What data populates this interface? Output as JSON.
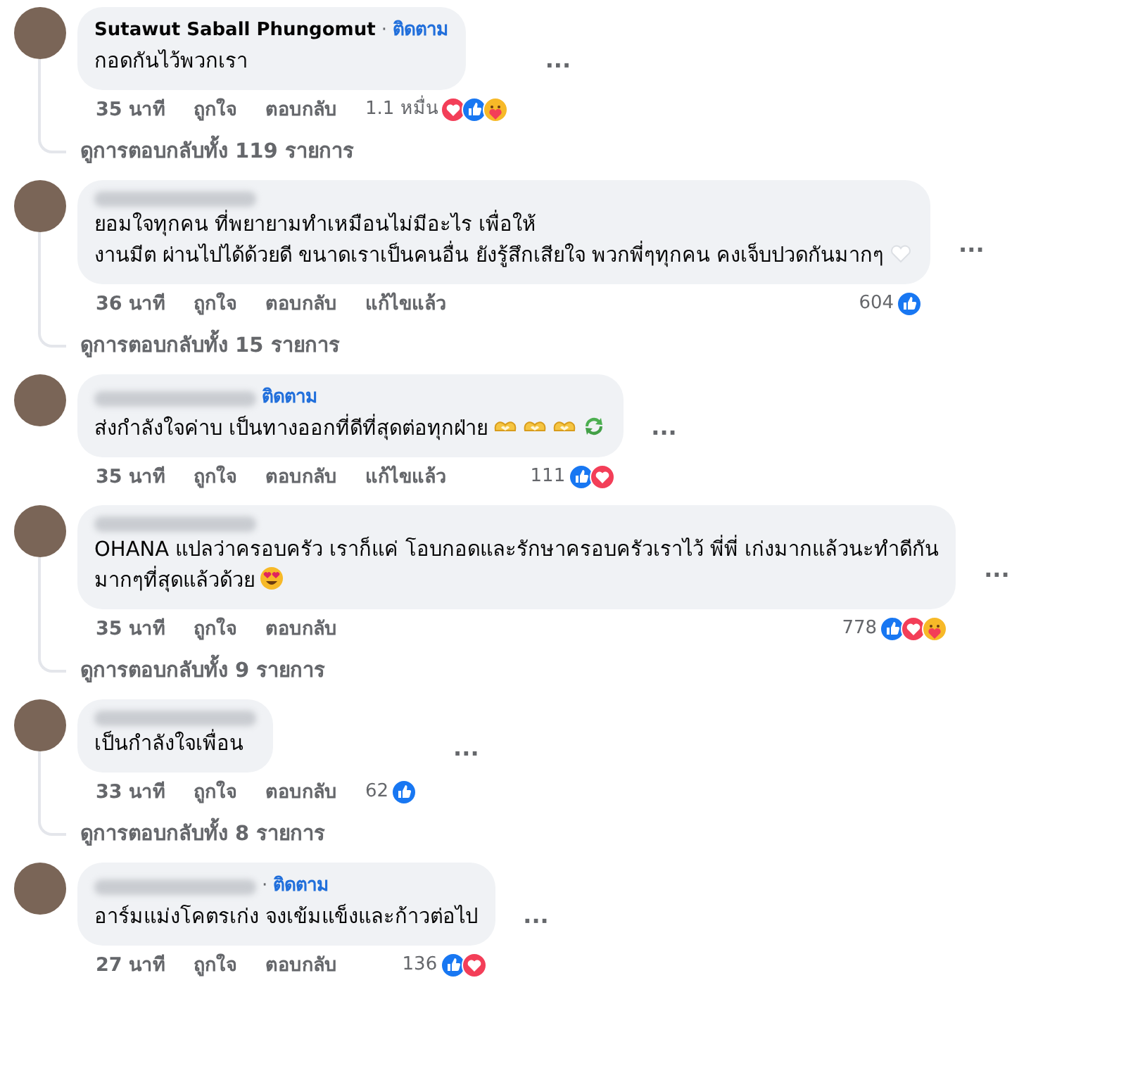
{
  "comments": [
    {
      "author": {
        "name": "Sutawut Saball Phungomut",
        "blurred": false
      },
      "separator": "·",
      "follow": "ติดตาม",
      "text": "กอดกันไว้พวกเรา",
      "more": "···",
      "time": "35 นาที",
      "actions": [
        "ถูกใจ",
        "ตอบกลับ"
      ],
      "reaction_count": "1.1 หมื่น",
      "reactions": [
        {
          "kind": "love"
        },
        {
          "kind": "like"
        },
        {
          "kind": "care"
        }
      ],
      "replies": "ดูการตอบกลับทั้ง 119 รายการ"
    },
    {
      "author": {
        "blurred": true
      },
      "text": "ยอมใจทุกคน ที่พยายามทำเหมือนไม่มีอะไร เพื่อให้\nงานมีต ผ่านไปได้ด้วยดี ขนาดเราเป็นคนอื่น ยังรู้สึกเสียใจ พวกพี่ๆทุกคน คงเจ็บปวดกันมากๆ",
      "emoji": [
        {
          "kind": "white-heart"
        }
      ],
      "more": "···",
      "time": "36 นาที",
      "actions": [
        "ถูกใจ",
        "ตอบกลับ"
      ],
      "edited": "แก้ไขแล้ว",
      "reaction_count": "604",
      "reactions": [
        {
          "kind": "like"
        }
      ],
      "replies": "ดูการตอบกลับทั้ง 15 รายการ"
    },
    {
      "author": {
        "blurred": true
      },
      "follow": "ติดตาม",
      "text": "ส่งกำลังใจค่าบ เป็นทางออกที่ดีที่สุดต่อทุกฝ่าย",
      "emoji": [
        {
          "kind": "heart-hands"
        },
        {
          "kind": "heart-hands"
        },
        {
          "kind": "heart-hands"
        },
        {
          "kind": "recycle"
        }
      ],
      "more": "···",
      "time": "35 นาที",
      "actions": [
        "ถูกใจ",
        "ตอบกลับ"
      ],
      "edited": "แก้ไขแล้ว",
      "reaction_count": "111",
      "reactions": [
        {
          "kind": "like"
        },
        {
          "kind": "love"
        }
      ]
    },
    {
      "author": {
        "blurred": true
      },
      "text": "OHANA แปลว่าครอบครัว เราก็แค่ โอบกอดและรักษาครอบครัวเราไว้ พี่พี่ เก่งมากแล้วนะทำดีกัน\nมากๆที่สุดแล้วด้วย",
      "emoji": [
        {
          "kind": "heart-eyes"
        }
      ],
      "more": "···",
      "time": "35 นาที",
      "actions": [
        "ถูกใจ",
        "ตอบกลับ"
      ],
      "reaction_count": "778",
      "reactions": [
        {
          "kind": "like"
        },
        {
          "kind": "love"
        },
        {
          "kind": "care"
        }
      ],
      "replies": "ดูการตอบกลับทั้ง 9 รายการ"
    },
    {
      "author": {
        "blurred": true
      },
      "text": "เป็นกำลังใจเพื่อน",
      "more": "···",
      "time": "33 นาที",
      "actions": [
        "ถูกใจ",
        "ตอบกลับ"
      ],
      "reaction_count": "62",
      "reactions": [
        {
          "kind": "like"
        }
      ],
      "replies": "ดูการตอบกลับทั้ง 8 รายการ"
    },
    {
      "author": {
        "blurred": true
      },
      "separator": "·",
      "follow": "ติดตาม",
      "text": "อาร์มแม่งโคตรเก่ง จงเข้มแข็งและก้าวต่อไป",
      "more": "···",
      "time": "27 นาที",
      "actions": [
        "ถูกใจ",
        "ตอบกลับ"
      ],
      "reaction_count": "136",
      "reactions": [
        {
          "kind": "like"
        },
        {
          "kind": "love"
        }
      ]
    }
  ]
}
